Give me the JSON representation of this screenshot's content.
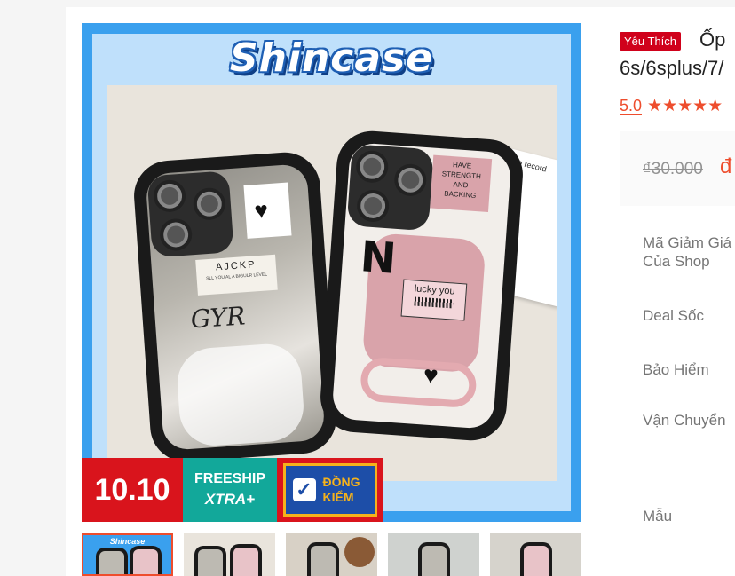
{
  "product": {
    "brand_watermark": "Shincase",
    "tag": "Yêu Thích",
    "title_line1": "Ốp",
    "title_line2": "6s/6splus/7/",
    "rating": "5.0",
    "stars": "★★★★★",
    "star_count": 5,
    "old_price": "₫30.000",
    "new_price": "đ"
  },
  "badges": {
    "sale": "10.10",
    "freeship_line1": "FREESHIP",
    "freeship_line2": "XTRA+",
    "dongkiem_line1": "ĐỒNG",
    "dongkiem_line2": "KIỂM",
    "dongkiem_check": "✓"
  },
  "case_art": {
    "left_label": "AJCKP",
    "left_sub": "SLL YOU AL A BIGULR LEVEL",
    "left_script": "GYR",
    "right_label": "lucky you",
    "right_sub1": "HAVE",
    "right_sub2": "STRENGTH",
    "right_sub3": "AND",
    "right_sub4": "BACKING",
    "right_letter": "N",
    "card_text": "We record"
  },
  "details": {
    "rows": [
      {
        "label_line1": "Mã Giảm Giá",
        "label_line2": "Của Shop"
      },
      {
        "label_line1": "Deal Sốc"
      },
      {
        "label_line1": "Bảo Hiểm"
      },
      {
        "label_line1": "Vận Chuyển"
      },
      {
        "label_line1": "Mẫu"
      }
    ]
  },
  "colors": {
    "accent": "#ee4d2d",
    "tag_red": "#d0011b",
    "frame_blue": "#3aa0ee",
    "freeship_teal": "#12a89a"
  }
}
